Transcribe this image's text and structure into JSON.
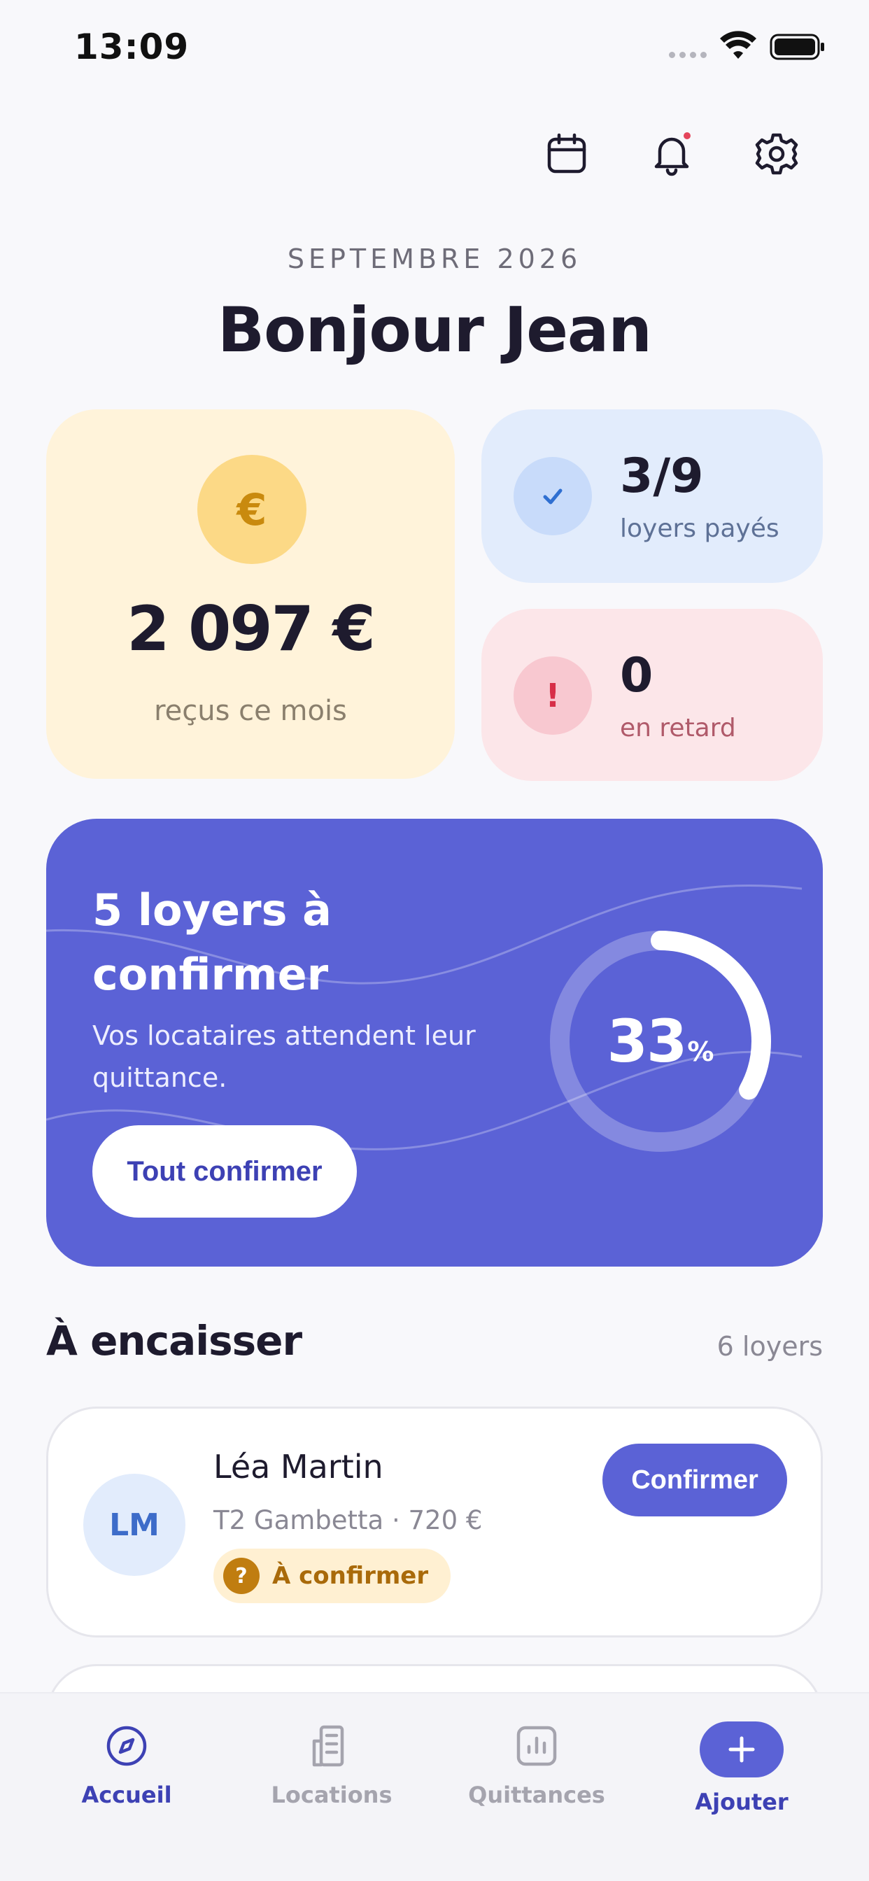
{
  "status_bar": {
    "time": "13:09"
  },
  "header": {
    "icons": [
      "calendar-icon",
      "bell-icon",
      "settings-icon"
    ],
    "notification_dot": true
  },
  "dashboard": {
    "date_label": "SEPTEMBRE 2026",
    "greeting": "Bonjour Jean"
  },
  "stats": {
    "revenue": {
      "currency_symbol": "€",
      "amount": "2 097 €",
      "label": "reçus ce mois"
    },
    "paid": {
      "value": "3/9",
      "label": "loyers payés"
    },
    "late": {
      "symbol": "!",
      "value": "0",
      "label": "en retard"
    }
  },
  "banner": {
    "title": "5 loyers à confirmer",
    "subtitle": "Vos locataires attendent leur quittance.",
    "button_label": "Tout confirmer",
    "progress_value": "33",
    "progress_unit": "%",
    "progress_fraction": 0.33
  },
  "section": {
    "title": "À encaisser",
    "count": "6 loyers"
  },
  "tenants": [
    {
      "initials": "LM",
      "name": "Léa Martin",
      "detail": "T2 Gambetta · 720 €",
      "status_symbol": "?",
      "status": "À confirmer",
      "action_label": "Confirmer"
    }
  ],
  "tab_bar": {
    "items": [
      {
        "label": "Accueil",
        "icon": "compass-icon",
        "active": true
      },
      {
        "label": "Locations",
        "icon": "building-icon",
        "active": false
      },
      {
        "label": "Quittances",
        "icon": "chart-icon",
        "active": false
      },
      {
        "label": "Ajouter",
        "icon": "plus-icon",
        "active": true
      }
    ]
  },
  "colors": {
    "accent": "#5B62D6",
    "revenue_card": "#FFF3DA",
    "paid_card": "#E2ECFC",
    "late_card": "#FCE6E9",
    "pending_badge": "#FFF0D2"
  }
}
